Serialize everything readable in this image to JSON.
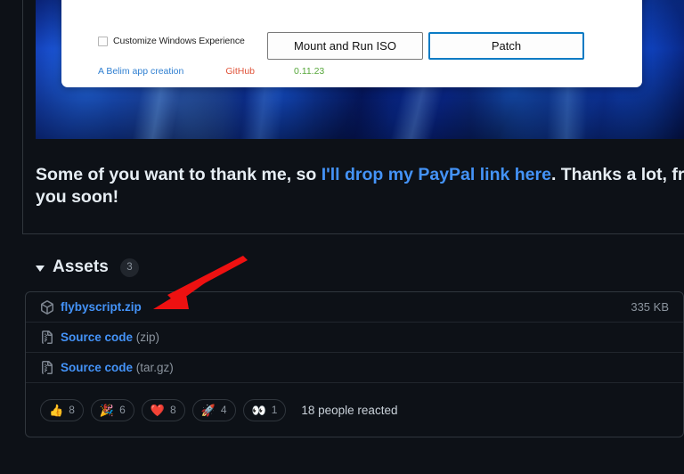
{
  "release_image": {
    "alt_name": "flyby-script-app-screenshot",
    "app": {
      "checkbox_label": "Customize Windows Experience",
      "checkbox_checked": false,
      "button_secondary": "Mount and Run ISO",
      "button_primary": "Patch",
      "link_author": "A Belim app creation",
      "link_github": "GitHub",
      "version": "0.11.23",
      "colors": {
        "author_link": "#2f7fd1",
        "github_link": "#e0543a",
        "version": "#58a83c",
        "primary_border": "#0a7bc4"
      }
    }
  },
  "body": {
    "line1_part1": "Some of you want to thank me, so ",
    "line1_link": "I'll drop my PayPal link here",
    "line1_part2": ". Thanks a lot, frie",
    "line2": "you soon!"
  },
  "assets": {
    "caret_icon": "triangle-down-icon",
    "title": "Assets",
    "count": "3",
    "rows": [
      {
        "icon": "package-icon",
        "name": "flybyscript.zip",
        "suffix": "",
        "size": "335 KB"
      },
      {
        "icon": "file-zip-icon",
        "name": "Source code",
        "suffix": " (zip)",
        "size": ""
      },
      {
        "icon": "file-zip-icon",
        "name": "Source code",
        "suffix": " (tar.gz)",
        "size": ""
      }
    ]
  },
  "reactions": {
    "pills": [
      {
        "emoji": "👍",
        "name": "thumbs-up",
        "count": "8"
      },
      {
        "emoji": "🎉",
        "name": "party-popper",
        "count": "6"
      },
      {
        "emoji": "❤️",
        "name": "heart",
        "count": "8"
      },
      {
        "emoji": "🚀",
        "name": "rocket",
        "count": "4"
      },
      {
        "emoji": "👀",
        "name": "eyes",
        "count": "1"
      }
    ],
    "summary": "18 people reacted"
  },
  "annotation": {
    "name": "red-arrow-pointing-to-flybyscript-zip",
    "color": "#ee1111"
  },
  "theme": {
    "page_bg": "#0d1117",
    "border": "#30363d",
    "link": "#4493f8",
    "text": "#e6edf3",
    "muted": "#8b949e"
  }
}
